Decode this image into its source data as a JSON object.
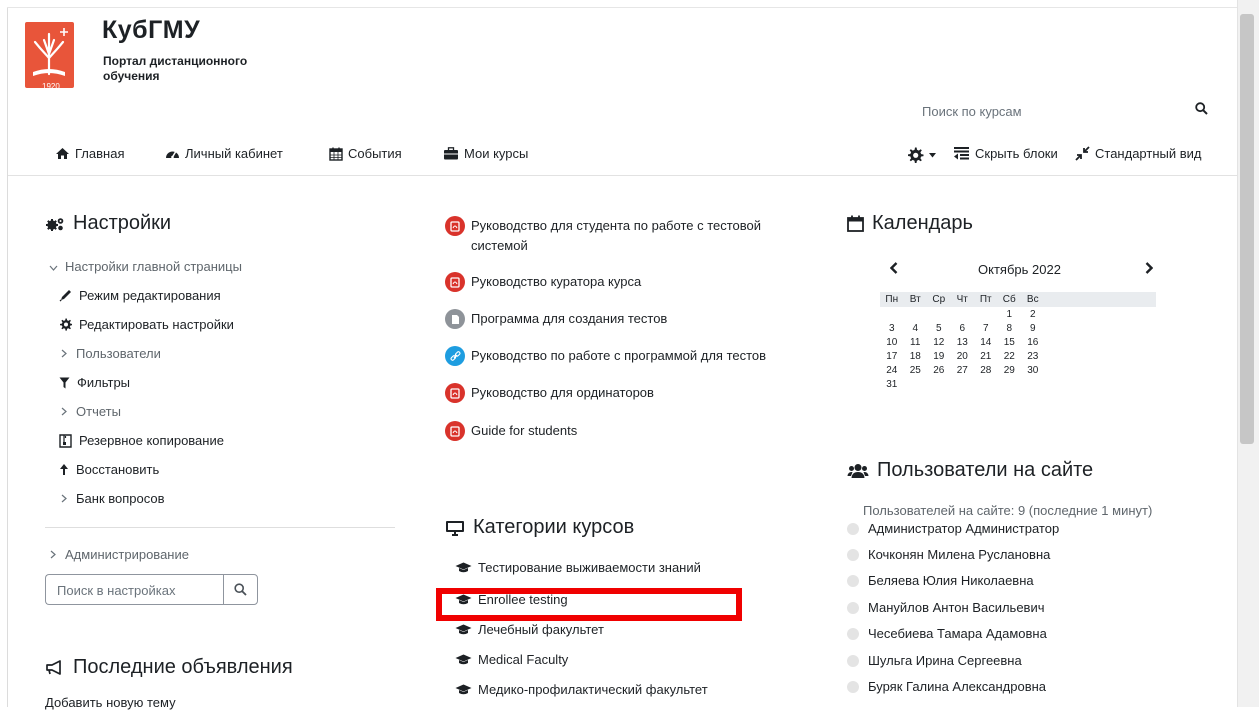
{
  "brand": {
    "name": "КубГМУ",
    "subtitle": "Портал дистанционного обучения",
    "logo_year": "1920"
  },
  "search": {
    "placeholder": "Поиск по курсам"
  },
  "nav": {
    "home": "Главная",
    "dashboard": "Личный кабинет",
    "events": "События",
    "my_courses": "Мои курсы",
    "hide_blocks": "Скрыть блоки",
    "standard_view": "Стандартный вид"
  },
  "settings_block": {
    "title": "Настройки",
    "front_page_settings": "Настройки главной страницы",
    "items": [
      "Режим редактирования",
      "Редактировать настройки",
      "Пользователи",
      "Фильтры",
      "Отчеты",
      "Резервное копирование",
      "Восстановить",
      "Банк вопросов"
    ],
    "administration": "Администрирование",
    "search_placeholder": "Поиск в настройках"
  },
  "announcements": {
    "title": "Последние объявления",
    "add_topic": "Добавить новую тему"
  },
  "resources": [
    {
      "label": "Руководство для студента по работе с тестовой системой",
      "icon": "pdf-icon"
    },
    {
      "label": "Руководство куратора курса",
      "icon": "pdf-icon"
    },
    {
      "label": "Программа для создания тестов",
      "icon": "file-icon"
    },
    {
      "label": "Руководство по работе с программой для тестов",
      "icon": "link-icon"
    },
    {
      "label": "Руководство для ординаторов",
      "icon": "pdf-icon"
    },
    {
      "label": "Guide for students",
      "icon": "pdf-icon"
    }
  ],
  "categories": {
    "title": "Категории курсов",
    "items": [
      "Тестирование выживаемости знаний",
      "Enrollee testing",
      "Лечебный факультет",
      "Medical Faculty",
      "Медико-профилактический факультет"
    ]
  },
  "calendar": {
    "title": "Календарь",
    "month": "Октябрь 2022",
    "weekdays": [
      "Пн",
      "Вт",
      "Ср",
      "Чт",
      "Пт",
      "Сб",
      "Вс"
    ],
    "weeks": [
      [
        "",
        "",
        "",
        "",
        "",
        "1",
        "2"
      ],
      [
        "3",
        "4",
        "5",
        "6",
        "7",
        "8",
        "9"
      ],
      [
        "10",
        "11",
        "12",
        "13",
        "14",
        "15",
        "16"
      ],
      [
        "17",
        "18",
        "19",
        "20",
        "21",
        "22",
        "23"
      ],
      [
        "24",
        "25",
        "26",
        "27",
        "28",
        "29",
        "30"
      ],
      [
        "31",
        "",
        "",
        "",
        "",
        "",
        ""
      ]
    ]
  },
  "online_users": {
    "title": "Пользователи на сайте",
    "summary": "Пользователей на сайте: 9 (последние 1 минут)",
    "users": [
      "Администратор Администратор",
      "Кочконян Милена Руслановна",
      "Беляева Юлия Николаевна",
      "Мануйлов Антон Васильевич",
      "Чесебиева Тамара Адамовна",
      "Шульга Ирина Сергеевна",
      "Буряк Галина Александровна"
    ]
  },
  "colors": {
    "brand": "#e8553a",
    "pdf": "#d9332b",
    "link": "#1e9de0",
    "highlight": "#f00000"
  }
}
